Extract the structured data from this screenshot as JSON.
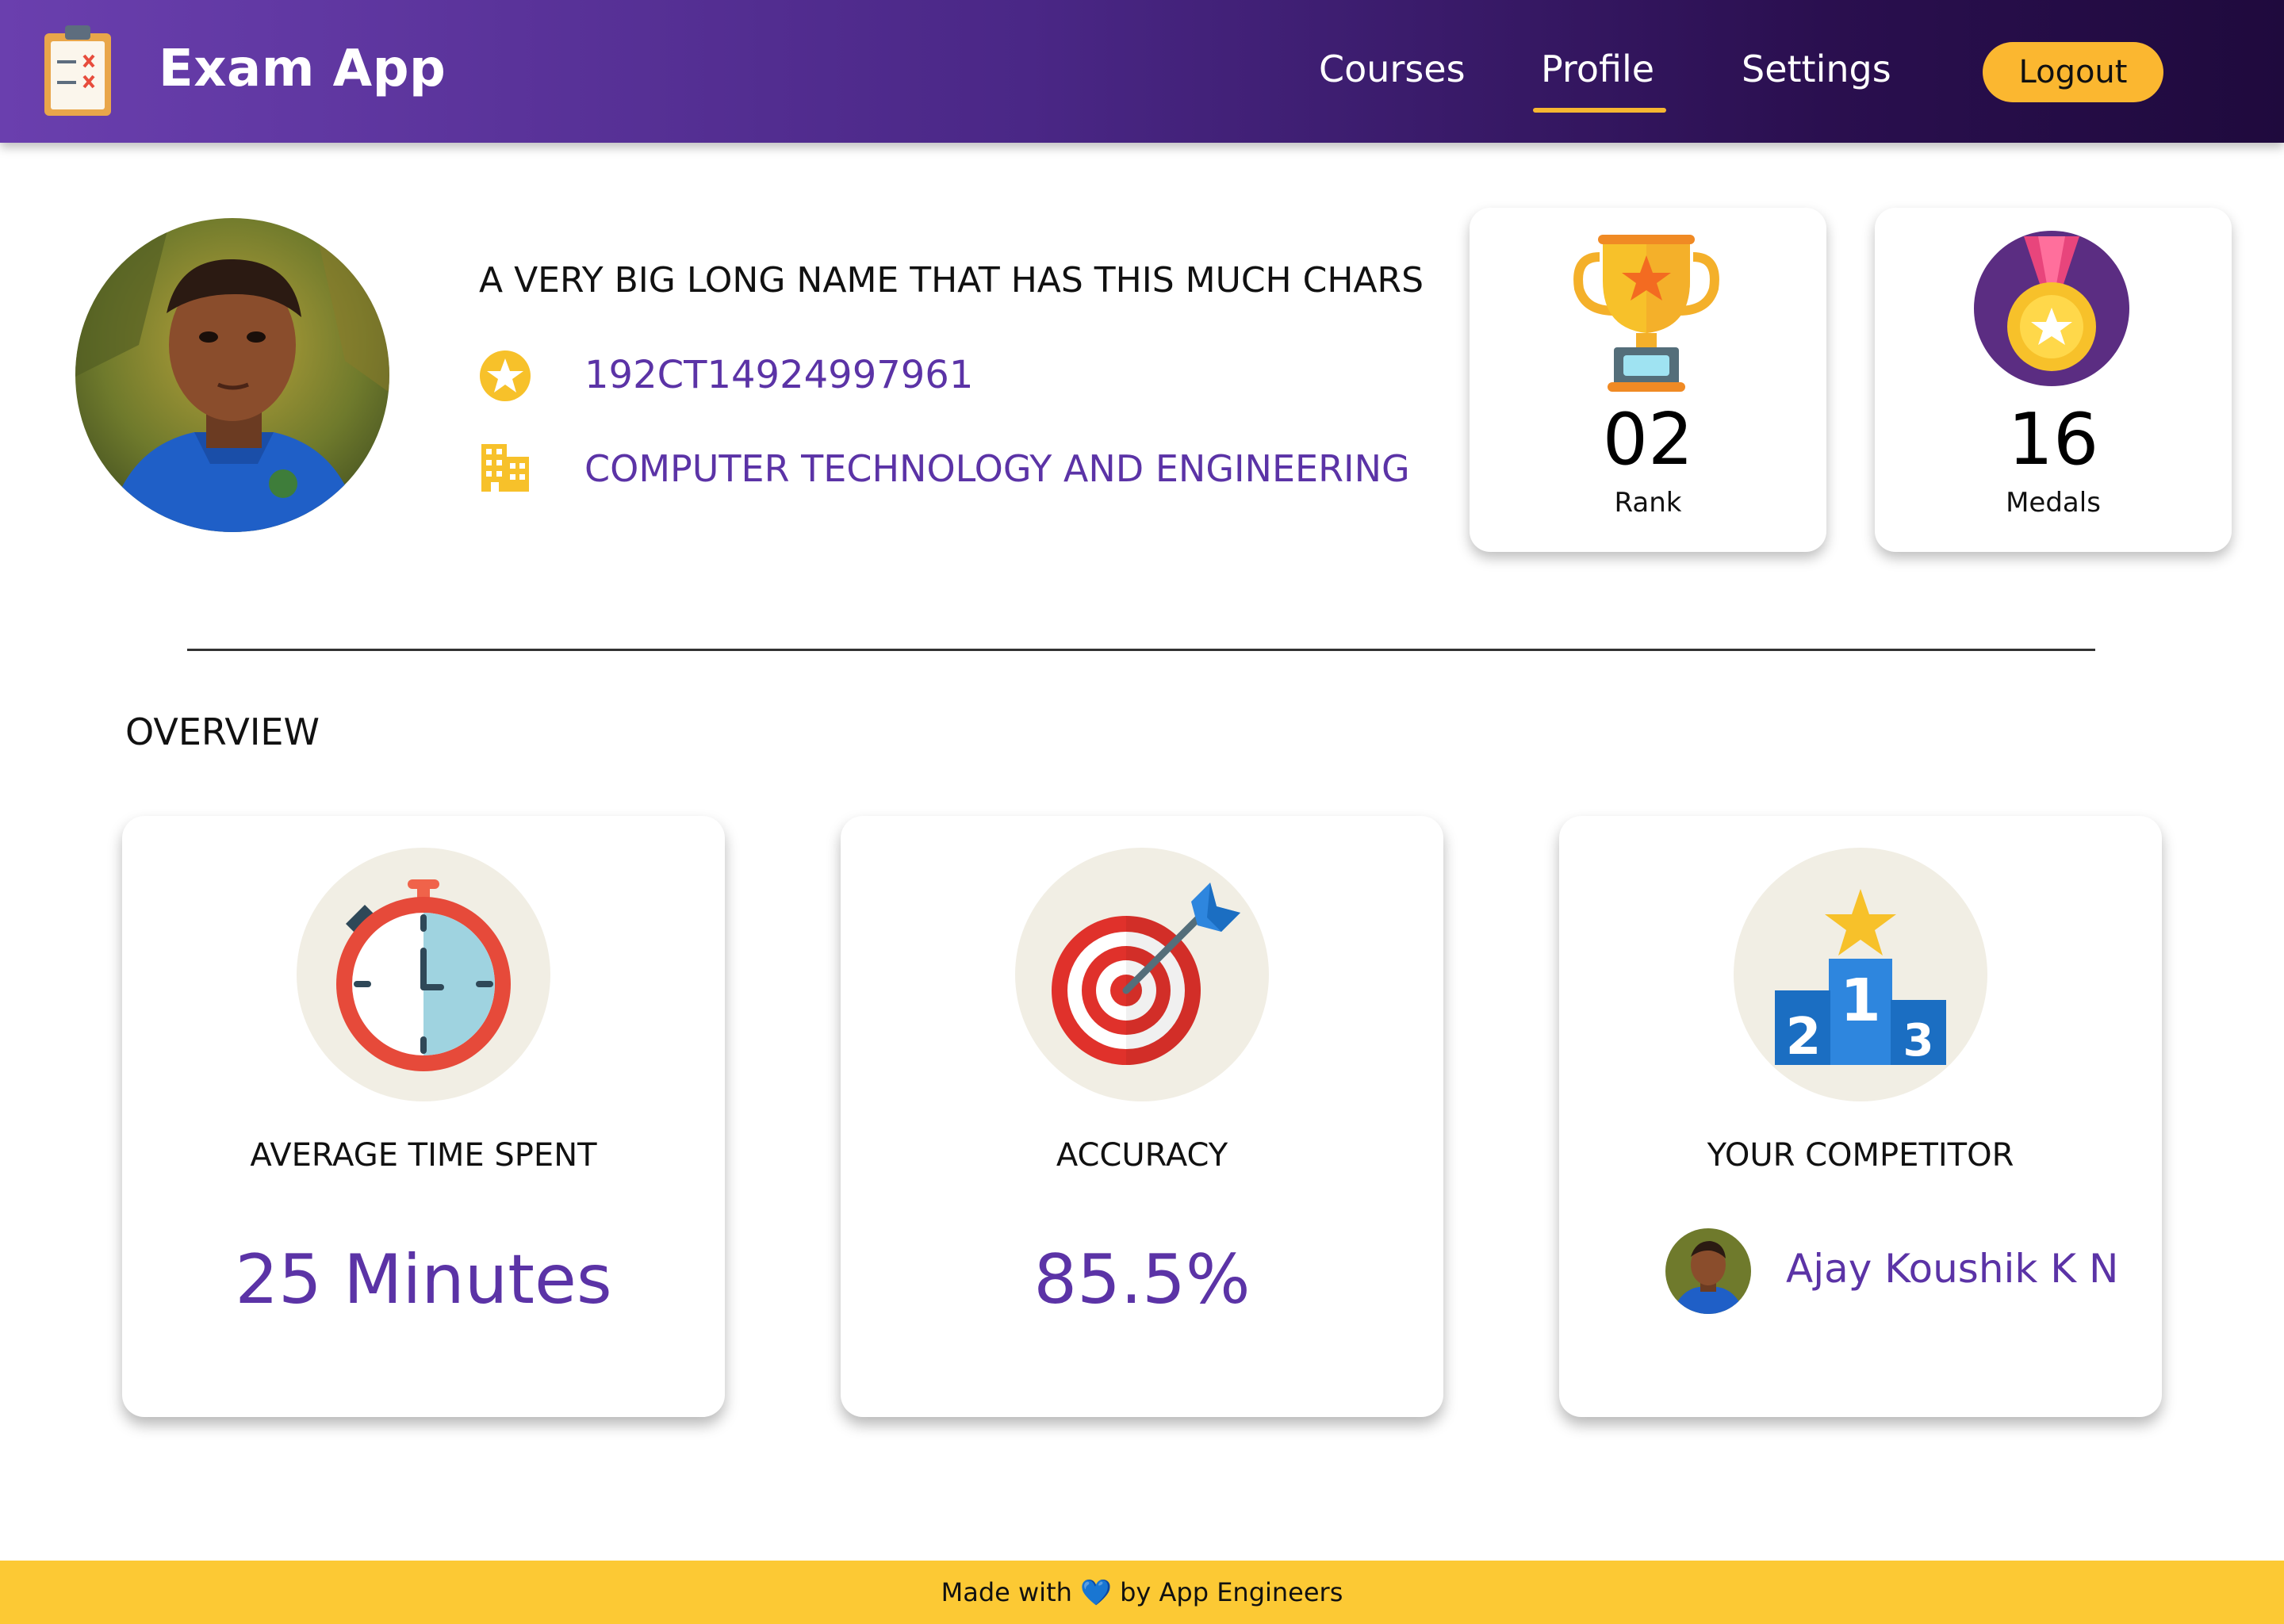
{
  "header": {
    "app_title": "Exam App",
    "nav": {
      "courses": "Courses",
      "profile": "Profile",
      "settings": "Settings"
    },
    "active_nav": "Profile",
    "logout_label": "Logout"
  },
  "profile": {
    "name": "A VERY BIG LONG NAME THAT HAS THIS MUCH CHARS",
    "id": "192CT14924997961",
    "department": "COMPUTER TECHNOLOGY AND ENGINEERING"
  },
  "stats": {
    "rank_value": "02",
    "rank_label": "Rank",
    "medals_value": "16",
    "medals_label": "Medals"
  },
  "overview": {
    "heading": "OVERVIEW",
    "time_title": "AVERAGE TIME SPENT",
    "time_value": "25 Minutes",
    "accuracy_title": "ACCURACY",
    "accuracy_value": "85.5%",
    "competitor_title": "YOUR COMPETITOR",
    "competitor_name": "Ajay Koushik K N"
  },
  "footer": {
    "prefix": "Made with",
    "heart": "💙",
    "suffix": "by App Engineers"
  },
  "colors": {
    "header_gradient_start": "#6a3fae",
    "header_gradient_end": "#1f0a3d",
    "accent_yellow": "#fbb730",
    "accent_purple": "#5b33a6",
    "footer_bg": "#fcc934"
  },
  "icons": {
    "logo": "clipboard-icon",
    "id": "star-badge-icon",
    "department": "building-icon",
    "rank": "trophy-icon",
    "medals": "medal-icon",
    "time": "stopwatch-icon",
    "accuracy": "target-icon",
    "competitor": "podium-icon"
  }
}
